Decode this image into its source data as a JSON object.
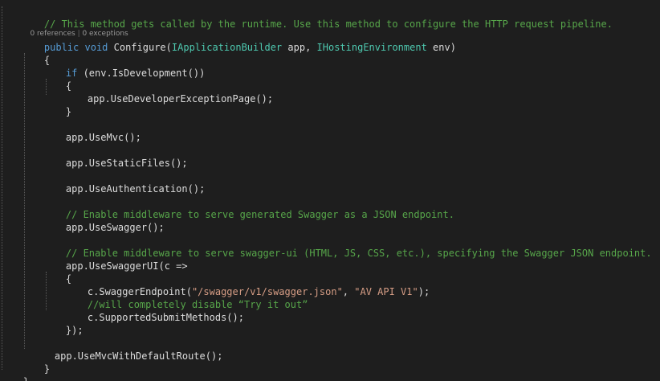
{
  "editor": {
    "comment_top": "// This method gets called by the runtime. Use this method to configure the HTTP request pipeline.",
    "codelens": {
      "references": "0 references",
      "separator": " | ",
      "exceptions": "0 exceptions"
    },
    "signature": {
      "modifier_public": "public",
      "modifier_void": "void",
      "method_name": " Configure(",
      "param1_type": "IApplicationBuilder",
      "param1_name": " app, ",
      "param2_type": "IHostingEnvironment",
      "param2_name": " env)"
    },
    "brace_open": "{",
    "if_keyword": "if",
    "if_condition": " (env.IsDevelopment())",
    "if_brace_open": "{",
    "dev_exception_page": "app.UseDeveloperExceptionPage();",
    "if_brace_close": "}",
    "use_mvc": "app.UseMvc();",
    "use_static_files": "app.UseStaticFiles();",
    "use_authentication": "app.UseAuthentication();",
    "comment_swagger": "// Enable middleware to serve generated Swagger as a JSON endpoint.",
    "use_swagger": "app.UseSwagger();",
    "comment_swagger_ui": "// Enable middleware to serve swagger-ui (HTML, JS, CSS, etc.), specifying the Swagger JSON endpoint.",
    "use_swagger_ui": "app.UseSwaggerUI(c =>",
    "lambda_brace_open": "{",
    "swagger_endpoint_call": "c.SwaggerEndpoint(",
    "swagger_endpoint_url": "\"/swagger/v1/swagger.json\"",
    "swagger_endpoint_comma": ", ",
    "swagger_endpoint_name": "\"AV API V1\"",
    "swagger_endpoint_end": ");",
    "comment_disable": "//will completely disable “Try it out”",
    "supported_submit_methods": "c.SupportedSubmitMethods();",
    "lambda_close": "});",
    "use_mvc_default_route": "app.UseMvcWithDefaultRoute();",
    "method_brace_close": "}",
    "class_brace_close": "}"
  }
}
